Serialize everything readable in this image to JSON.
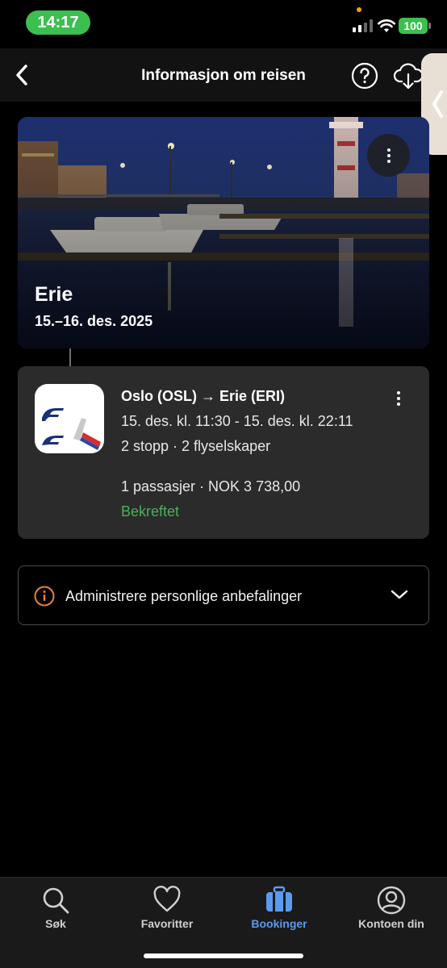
{
  "status_bar": {
    "time": "14:17",
    "battery": "100",
    "icons": [
      "signal-icon",
      "wifi-icon",
      "battery-icon"
    ]
  },
  "header": {
    "title": "Informasjon om reisen",
    "icons": [
      "back-arrow-icon",
      "help-icon",
      "cloud-download-icon"
    ]
  },
  "trip": {
    "city": "Erie",
    "dates": "15.–16. des. 2025"
  },
  "flight": {
    "route": "Oslo (OSL) → Erie (ERI)",
    "times": "15. des. kl. 11:30 - 15. des. kl. 22:11",
    "stops": "2 stopp · 2 flyselskaper",
    "price": "1 passasjer · NOK 3 738,00",
    "status": "Bekreftet",
    "status_color": "#4caf5a"
  },
  "recommendations": {
    "label": "Administrere personlige anbefalinger",
    "icon_color": "#e8823a"
  },
  "bottom_nav": {
    "items": [
      {
        "label": "Søk",
        "icon": "search-icon"
      },
      {
        "label": "Favoritter",
        "icon": "heart-icon"
      },
      {
        "label": "Bookinger",
        "icon": "suitcase-icon",
        "active": true
      },
      {
        "label": "Kontoen din",
        "icon": "account-icon"
      }
    ],
    "active_color": "#5a9bf0"
  }
}
